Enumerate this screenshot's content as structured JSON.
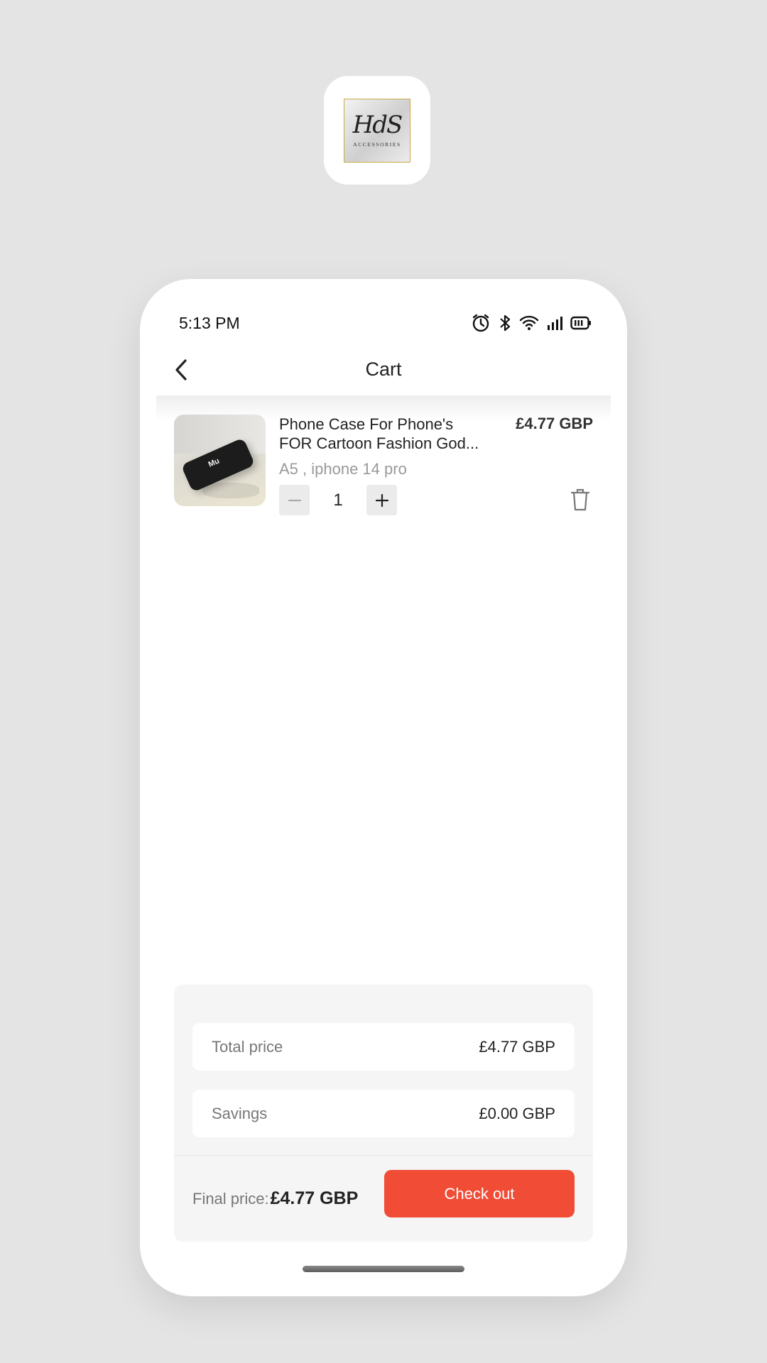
{
  "app_icon": {
    "logo_mark": "HdS",
    "logo_sub": "ACCESSORIES"
  },
  "status_bar": {
    "time": "5:13 PM",
    "icons": [
      "alarm-icon",
      "bluetooth-icon",
      "wifi-icon",
      "signal-icon",
      "battery-icon"
    ]
  },
  "nav": {
    "title": "Cart",
    "back_icon": "chevron-left-icon"
  },
  "cart": {
    "items": [
      {
        "title_line1": "Phone Case For Phone's",
        "title_line2": "FOR Cartoon Fashion God...",
        "price": "£4.77 GBP",
        "variant": "A5 , iphone 14 pro",
        "quantity": "1",
        "thumb_text": "Mu"
      }
    ]
  },
  "summary": {
    "total_label": "Total price",
    "total_value": "£4.77 GBP",
    "savings_label": "Savings",
    "savings_value": "£0.00 GBP",
    "final_label": "Final price:",
    "final_value": "£4.77 GBP",
    "checkout_label": "Check out"
  },
  "colors": {
    "accent": "#f04c36",
    "background": "#e4e4e4",
    "card": "#f5f5f5"
  }
}
